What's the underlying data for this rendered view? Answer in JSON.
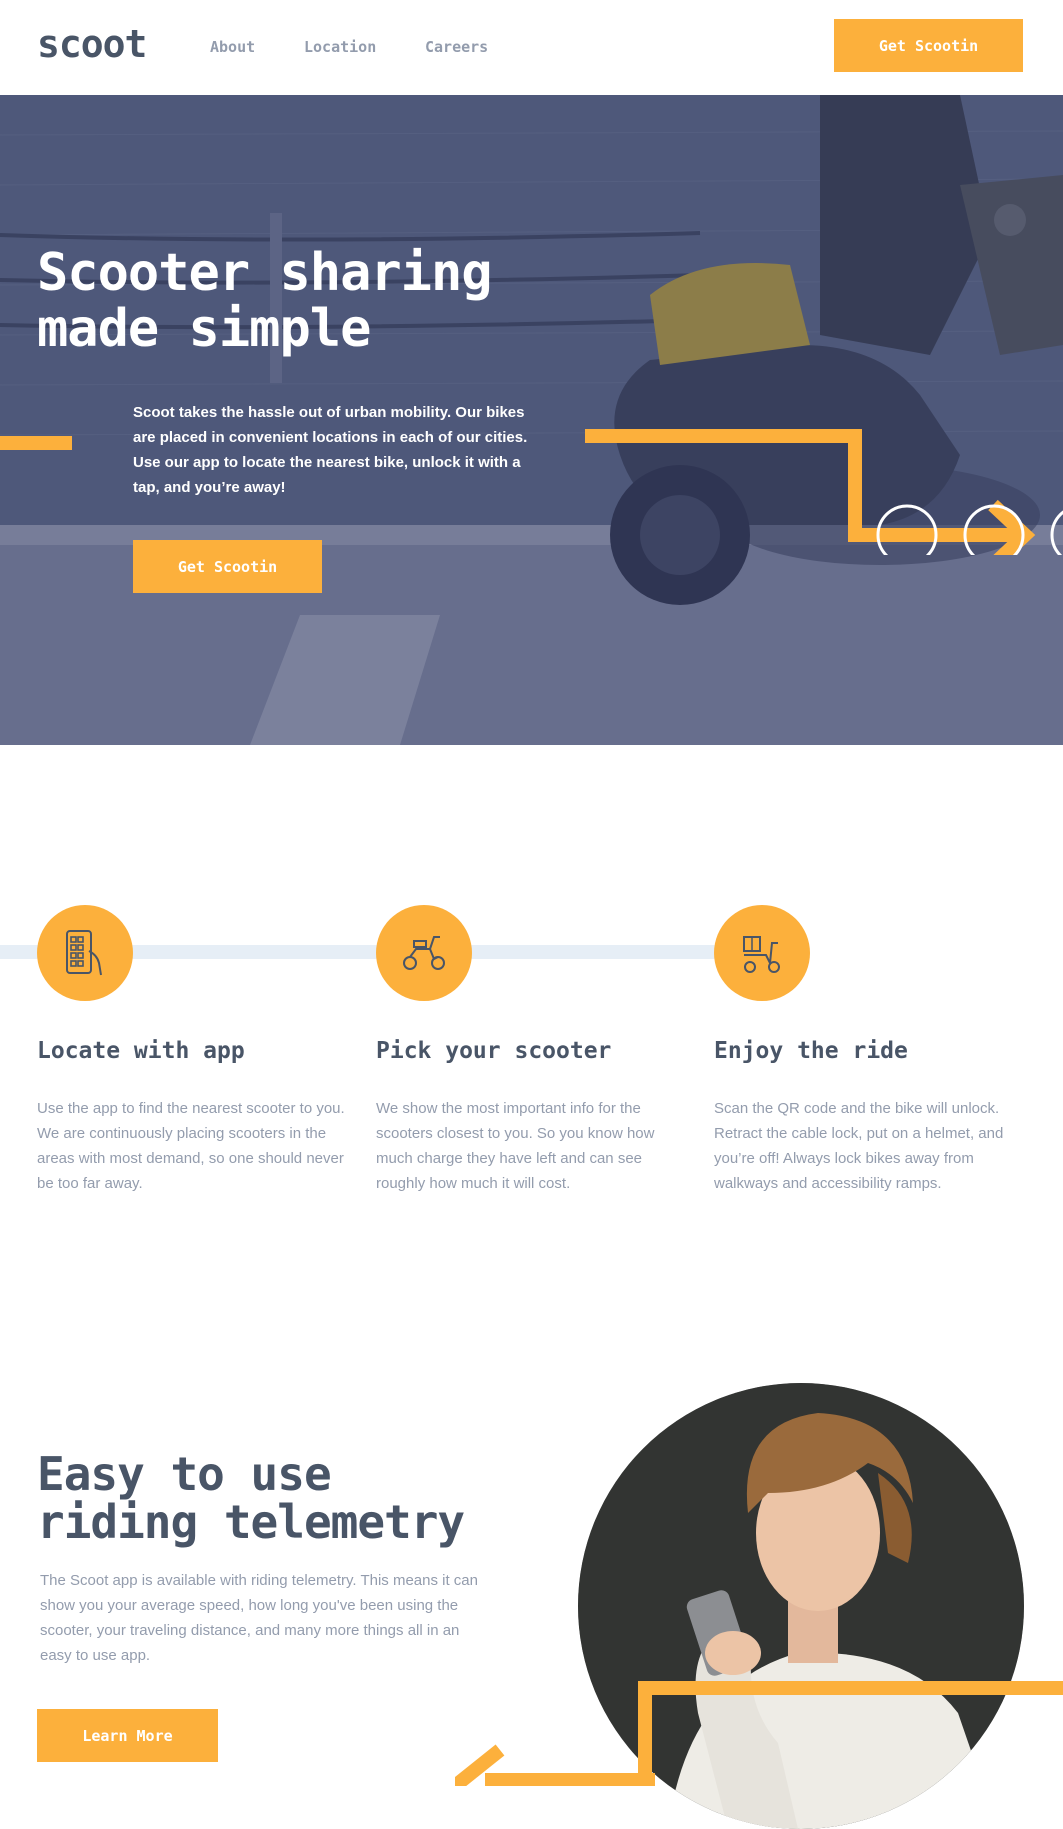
{
  "header": {
    "logo": "scoot",
    "nav": [
      "About",
      "Location",
      "Careers"
    ],
    "cta_label": "Get Scootin"
  },
  "hero": {
    "title_line1": "Scooter sharing",
    "title_line2": "made simple",
    "description": "Scoot takes the hassle out of urban mobility. Our bikes are placed in convenient locations in each of our cities. Use our app to locate the nearest bike, unlock it with a tap, and you’re away!",
    "cta_label": "Get Scootin"
  },
  "features": [
    {
      "icon": "phone-app-icon",
      "title": "Locate with app",
      "text": "Use the app to find the nearest scooter to you. We are continuously placing scooters in the areas with most demand, so one should never be too far away."
    },
    {
      "icon": "scooter-icon",
      "title": "Pick your scooter",
      "text": "We show the most important info for the scooters closest to you. So you know how much charge they have left and can see roughly how much it will cost."
    },
    {
      "icon": "delivery-scooter-icon",
      "title": "Enjoy the ride",
      "text": "Scan the QR code and the bike will unlock. Retract the cable lock, put on a helmet, and you’re off! Always lock bikes away from walkways and accessibility ramps."
    }
  ],
  "telemetry": {
    "title_line1": "Easy to use",
    "title_line2": "riding telemetry",
    "text": "The Scoot app is available with riding telemetry. This means it can show you your average speed, how long you've been using the scooter, your traveling distance, and many more things all in an easy to use app.",
    "cta_label": "Learn More"
  },
  "colors": {
    "accent": "#fcb03c",
    "dark": "#495567",
    "muted": "#939cad",
    "light_line": "#e6eef6",
    "hero_overlay": "#4d5678"
  }
}
